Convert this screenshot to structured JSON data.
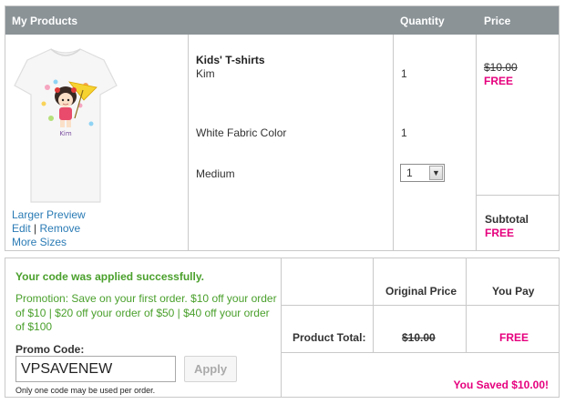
{
  "header": {
    "products": "My Products",
    "quantity": "Quantity",
    "price": "Price"
  },
  "product": {
    "name": "Kids' T-shirts",
    "design": "Kim",
    "color": "White Fabric Color",
    "size": "Medium",
    "shirt_text": "Kim",
    "quantity_design": "1",
    "quantity_color": "1",
    "quantity_select": "1",
    "original_price": "$10.00",
    "price": "FREE",
    "links": {
      "larger_preview": "Larger Preview",
      "edit": "Edit",
      "separator": "|",
      "remove": "Remove",
      "more_sizes": "More Sizes"
    }
  },
  "subtotal": {
    "label": "Subtotal",
    "value": "FREE"
  },
  "promo": {
    "success": "Your code was applied successfully.",
    "description": "Promotion: Save on your first order. $10 off your order of $10 | $20 off your order of $50 | $40 off your order of $100",
    "label": "Promo Code:",
    "code": "VPSAVENEW",
    "apply": "Apply",
    "note": "Only one code may be used per order."
  },
  "totals": {
    "original_price_header": "Original Price",
    "you_pay_header": "You Pay",
    "product_total_label": "Product Total:",
    "original_total": "$10.00",
    "you_pay": "FREE",
    "saved": "You Saved $10.00!"
  },
  "colors": {
    "header_bg": "#8b9397",
    "link": "#2a7bb5",
    "success": "#4aa02c",
    "accent": "#e6007e"
  },
  "icons": {
    "select_arrow": "chevron-down-icon"
  }
}
